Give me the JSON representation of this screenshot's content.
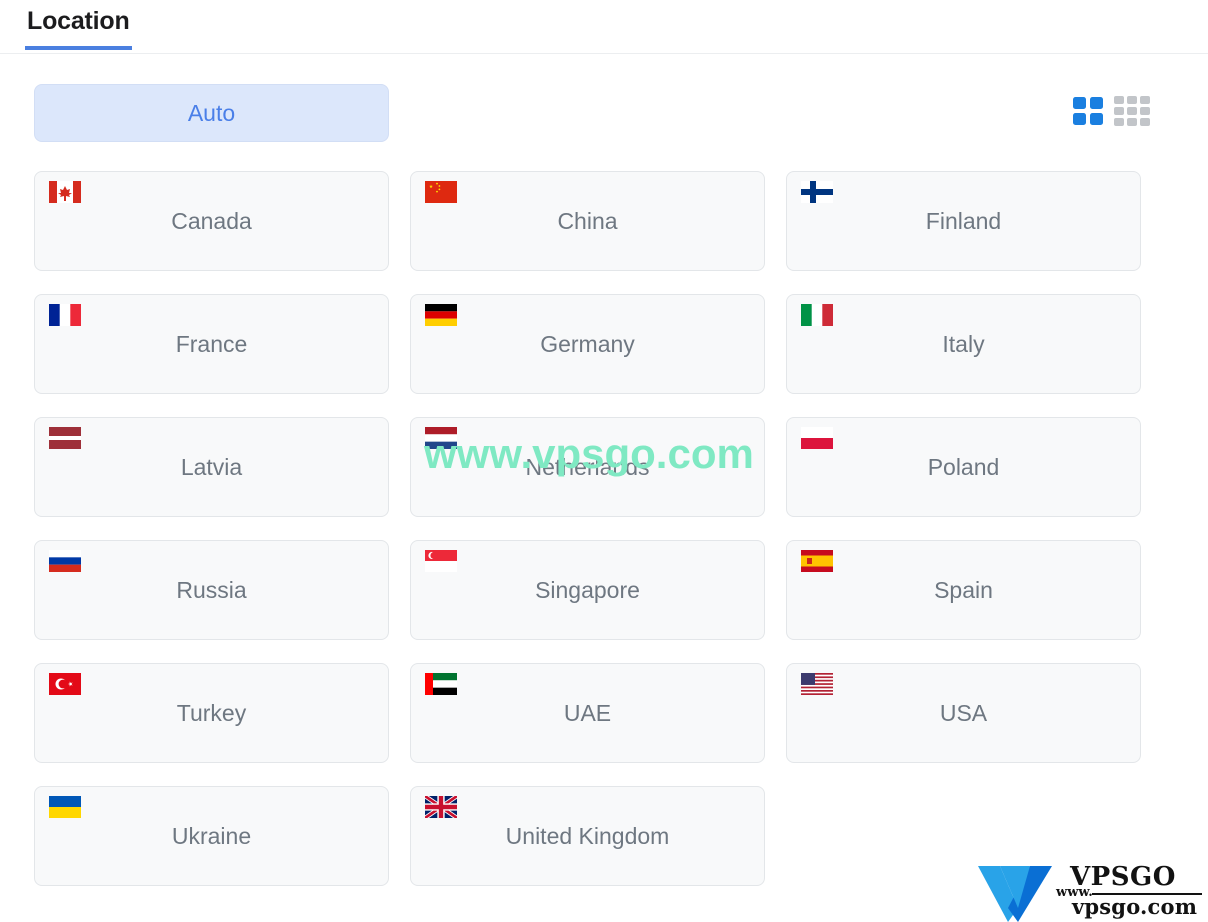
{
  "header": {
    "tab_label": "Location",
    "accent_color": "#4a7fe0"
  },
  "controls": {
    "auto_label": "Auto",
    "auto_bg_color": "#dce7fb",
    "auto_text_color": "#4a7fe8",
    "view_toggle": {
      "grid_large_icon": "grid-2x2-icon",
      "grid_large_active": "true",
      "grid_large_color": "#1a7fe0",
      "grid_small_icon": "grid-3x3-icon",
      "grid_small_active": "false",
      "grid_small_color": "#c2c5c9"
    }
  },
  "countries": [
    {
      "name": "Canada",
      "flag": "flag-canada",
      "code": "ca"
    },
    {
      "name": "China",
      "flag": "flag-china",
      "code": "cn"
    },
    {
      "name": "Finland",
      "flag": "flag-finland",
      "code": "fi"
    },
    {
      "name": "France",
      "flag": "flag-france",
      "code": "fr"
    },
    {
      "name": "Germany",
      "flag": "flag-germany",
      "code": "de"
    },
    {
      "name": "Italy",
      "flag": "flag-italy",
      "code": "it"
    },
    {
      "name": "Latvia",
      "flag": "flag-latvia",
      "code": "lv"
    },
    {
      "name": "Netherlands",
      "flag": "flag-netherlands",
      "code": "nl"
    },
    {
      "name": "Poland",
      "flag": "flag-poland",
      "code": "pl"
    },
    {
      "name": "Russia",
      "flag": "flag-russia",
      "code": "ru"
    },
    {
      "name": "Singapore",
      "flag": "flag-singapore",
      "code": "sg"
    },
    {
      "name": "Spain",
      "flag": "flag-spain",
      "code": "es"
    },
    {
      "name": "Turkey",
      "flag": "flag-turkey",
      "code": "tr"
    },
    {
      "name": "UAE",
      "flag": "flag-uae",
      "code": "ae"
    },
    {
      "name": "USA",
      "flag": "flag-usa",
      "code": "us"
    },
    {
      "name": "Ukraine",
      "flag": "flag-ukraine",
      "code": "ua"
    },
    {
      "name": "United Kingdom",
      "flag": "flag-united-kingdom",
      "code": "gb"
    }
  ],
  "watermark": {
    "text": "www.vpsgo.com",
    "color": "#7fe9c3"
  },
  "logo": {
    "mark": "letter-v-mark",
    "name": "VPSGO",
    "www": "www.",
    "domain": "vpsgo.com",
    "color_light": "#29a3e8",
    "color_dark": "#0a6fd4"
  }
}
